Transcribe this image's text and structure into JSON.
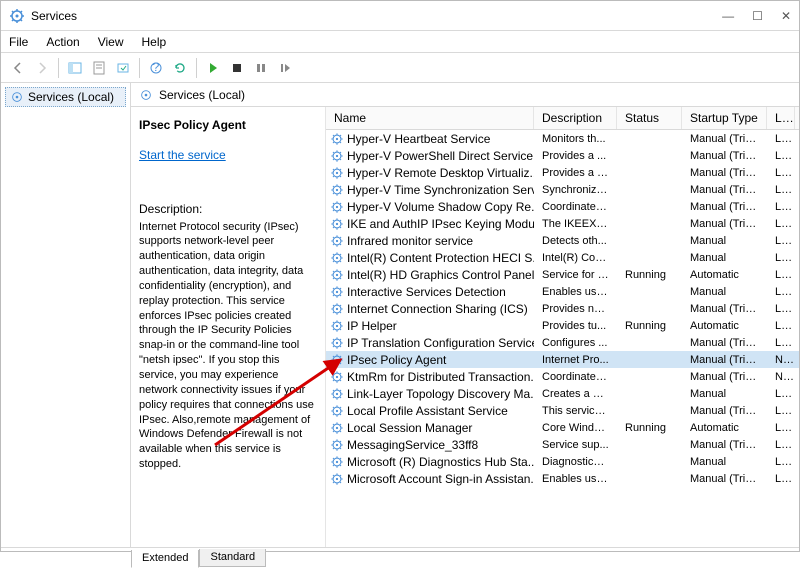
{
  "window": {
    "title": "Services",
    "minimize": "—",
    "maximize": "☐",
    "close": "✕"
  },
  "menubar": [
    "File",
    "Action",
    "View",
    "Help"
  ],
  "tree": {
    "root": "Services (Local)"
  },
  "content_header": "Services (Local)",
  "detail": {
    "service_name": "IPsec Policy Agent",
    "start_link": "Start the service",
    "desc_label": "Description:",
    "desc_text": "Internet Protocol security (IPsec) supports network-level peer authentication, data origin authentication, data integrity, data confidentiality (encryption), and replay protection.  This service enforces IPsec policies created through the IP Security Policies snap-in or the command-line tool \"netsh ipsec\".  If you stop this service, you may experience network connectivity issues if your policy requires that connections use IPsec.  Also,remote management of Windows Defender Firewall is not available when this service is stopped."
  },
  "columns": {
    "name": "Name",
    "description": "Description",
    "status": "Status",
    "startup": "Startup Type",
    "logon": "Log"
  },
  "services": [
    {
      "name": "Hyper-V Heartbeat Service",
      "desc": "Monitors th...",
      "status": "",
      "start": "Manual (Trig...",
      "logon": "Loc"
    },
    {
      "name": "Hyper-V PowerShell Direct Service",
      "desc": "Provides a ...",
      "status": "",
      "start": "Manual (Trig...",
      "logon": "Loc"
    },
    {
      "name": "Hyper-V Remote Desktop Virtualiz...",
      "desc": "Provides a p...",
      "status": "",
      "start": "Manual (Trig...",
      "logon": "Loc"
    },
    {
      "name": "Hyper-V Time Synchronization Serv...",
      "desc": "Synchronize...",
      "status": "",
      "start": "Manual (Trig...",
      "logon": "Loc"
    },
    {
      "name": "Hyper-V Volume Shadow Copy Re...",
      "desc": "Coordinates...",
      "status": "",
      "start": "Manual (Trig...",
      "logon": "Loc"
    },
    {
      "name": "IKE and AuthIP IPsec Keying Modu...",
      "desc": "The IKEEXT ...",
      "status": "",
      "start": "Manual (Trig...",
      "logon": "Loc"
    },
    {
      "name": "Infrared monitor service",
      "desc": "Detects oth...",
      "status": "",
      "start": "Manual",
      "logon": "Loc"
    },
    {
      "name": "Intel(R) Content Protection HECI S...",
      "desc": "Intel(R) Con...",
      "status": "",
      "start": "Manual",
      "logon": "Loc"
    },
    {
      "name": "Intel(R) HD Graphics Control Panel...",
      "desc": "Service for I...",
      "status": "Running",
      "start": "Automatic",
      "logon": "Loc"
    },
    {
      "name": "Interactive Services Detection",
      "desc": "Enables use...",
      "status": "",
      "start": "Manual",
      "logon": "Loc"
    },
    {
      "name": "Internet Connection Sharing (ICS)",
      "desc": "Provides ne...",
      "status": "",
      "start": "Manual (Trig...",
      "logon": "Loc"
    },
    {
      "name": "IP Helper",
      "desc": "Provides tu...",
      "status": "Running",
      "start": "Automatic",
      "logon": "Loc"
    },
    {
      "name": "IP Translation Configuration Service",
      "desc": "Configures ...",
      "status": "",
      "start": "Manual (Trig...",
      "logon": "Loc"
    },
    {
      "name": "IPsec Policy Agent",
      "desc": "Internet Pro...",
      "status": "",
      "start": "Manual (Trig...",
      "logon": "Net",
      "selected": true
    },
    {
      "name": "KtmRm for Distributed Transaction...",
      "desc": "Coordinates...",
      "status": "",
      "start": "Manual (Trig...",
      "logon": "Net"
    },
    {
      "name": "Link-Layer Topology Discovery Ma...",
      "desc": "Creates a N...",
      "status": "",
      "start": "Manual",
      "logon": "Loc"
    },
    {
      "name": "Local Profile Assistant Service",
      "desc": "This service ...",
      "status": "",
      "start": "Manual (Trig...",
      "logon": "Loc"
    },
    {
      "name": "Local Session Manager",
      "desc": "Core Windo...",
      "status": "Running",
      "start": "Automatic",
      "logon": "Loc"
    },
    {
      "name": "MessagingService_33ff8",
      "desc": "Service sup...",
      "status": "",
      "start": "Manual (Trig...",
      "logon": "Loc"
    },
    {
      "name": "Microsoft (R) Diagnostics Hub Sta...",
      "desc": "Diagnostics ...",
      "status": "",
      "start": "Manual",
      "logon": "Loc"
    },
    {
      "name": "Microsoft Account Sign-in Assistan...",
      "desc": "Enables use...",
      "status": "",
      "start": "Manual (Trig...",
      "logon": "Loc"
    }
  ],
  "tabs": {
    "extended": "Extended",
    "standard": "Standard"
  }
}
